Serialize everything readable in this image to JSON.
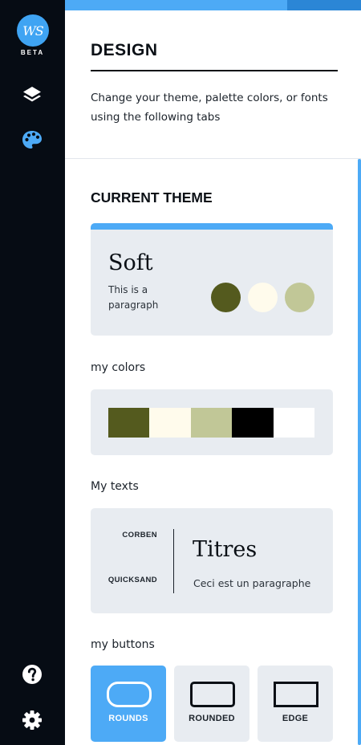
{
  "app": {
    "logo_text": "WS",
    "beta_label": "BETA"
  },
  "sidebar": {
    "items": [
      {
        "name": "layers",
        "icon": "layers-icon"
      },
      {
        "name": "design",
        "icon": "palette-icon",
        "active": true
      },
      {
        "name": "help",
        "icon": "help-icon"
      },
      {
        "name": "settings",
        "icon": "gear-icon"
      }
    ]
  },
  "progress": {
    "fraction": 0.75
  },
  "header": {
    "title": "DESIGN",
    "description": "Change your theme, palette colors, or fonts using the following tabs"
  },
  "current_theme": {
    "heading": "CURRENT THEME",
    "name": "Soft",
    "paragraph": "This is a paragraph",
    "colors": [
      "#545a1e",
      "#fffbec",
      "#c1c797"
    ]
  },
  "my_colors": {
    "label": "my colors",
    "palette": [
      "#545a1e",
      "#fffbec",
      "#c1c797",
      "#000000",
      "#ffffff"
    ]
  },
  "my_texts": {
    "label": "My texts",
    "title_font": "CORBEN",
    "body_font": "QUICKSAND",
    "title_sample": "Titres",
    "paragraph_sample": "Ceci est un paragraphe"
  },
  "my_buttons": {
    "label": "my buttons",
    "options": [
      {
        "label": "ROUNDS",
        "active": true
      },
      {
        "label": "ROUNDED",
        "active": false
      },
      {
        "label": "EDGE",
        "active": false
      }
    ]
  },
  "colors": {
    "accent": "#4daaf6",
    "sidebar_bg": "#060c14",
    "card_bg": "#e8ecf1"
  }
}
